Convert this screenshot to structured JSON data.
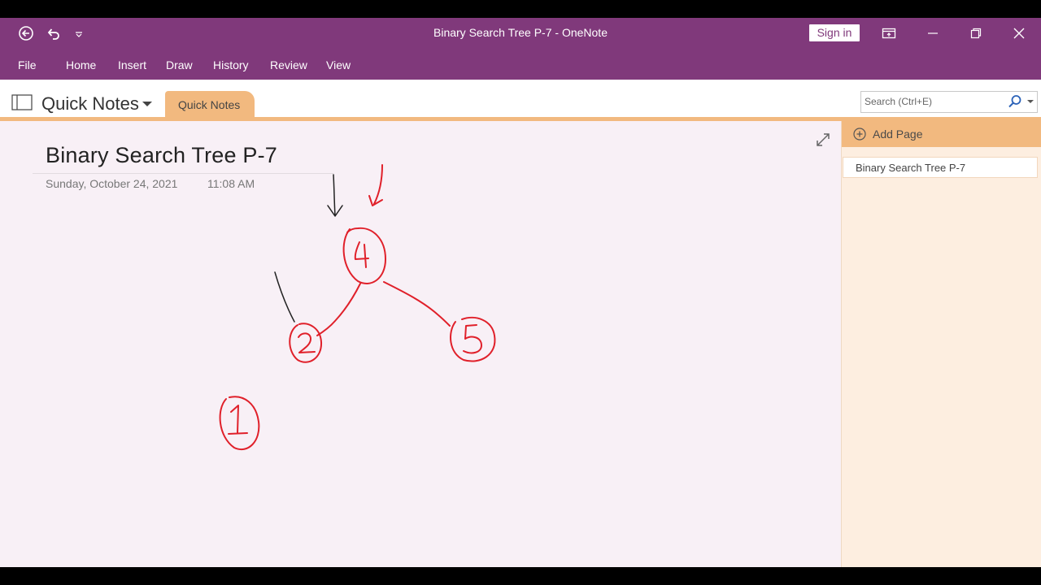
{
  "window": {
    "title": "Binary Search Tree  P-7  -  OneNote",
    "sign_in_label": "Sign in"
  },
  "menu": [
    "File",
    "Home",
    "Insert",
    "Draw",
    "History",
    "Review",
    "View"
  ],
  "notebook": {
    "name": "Quick Notes",
    "section_tab": "Quick Notes"
  },
  "search": {
    "placeholder": "Search (Ctrl+E)"
  },
  "page": {
    "title": "Binary Search Tree  P-7",
    "date": "Sunday, October 24, 2021",
    "time": "11:08 AM"
  },
  "ink_nodes": [
    "4",
    "2",
    "5",
    "1"
  ],
  "pages_pane": {
    "add_page_label": "Add Page",
    "pages": [
      "Binary Search Tree  P-7"
    ]
  },
  "colors": {
    "title_bar": "#80397b",
    "section_tab": "#f2b97f",
    "canvas": "#f8f0f6",
    "pages_pane": "#fdeee0",
    "ink_red": "#e0202a"
  }
}
